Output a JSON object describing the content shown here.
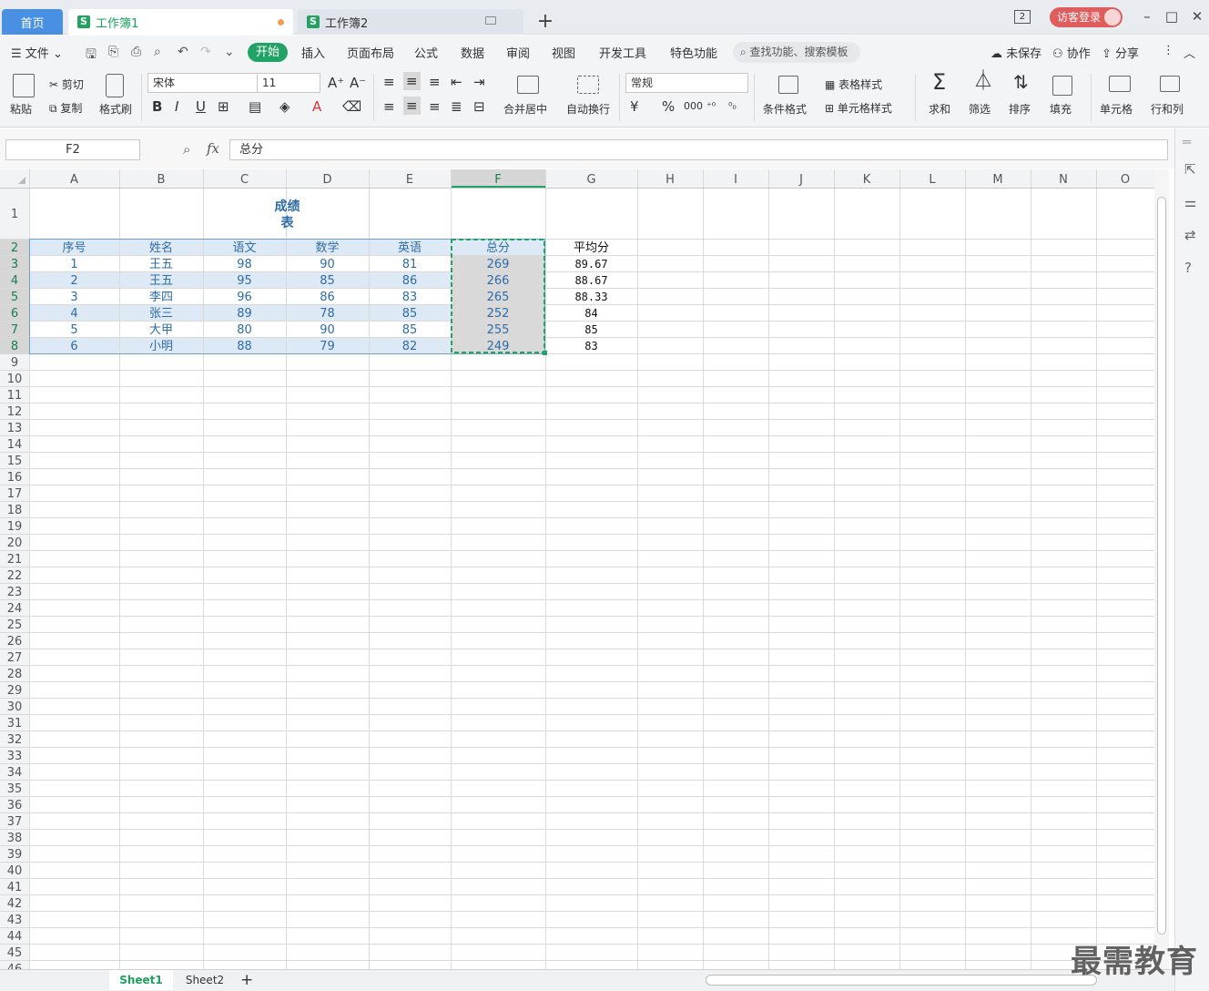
{
  "tabs": {
    "home": "首页",
    "wb1": "工作簿1",
    "wb2": "工作簿2",
    "new": "+"
  },
  "top_right": {
    "window_count": "2",
    "login": "访客登录"
  },
  "menu": {
    "file": "文件",
    "items": [
      "开始",
      "插入",
      "页面布局",
      "公式",
      "数据",
      "审阅",
      "视图",
      "开发工具",
      "特色功能"
    ],
    "search": "查找功能、搜索模板",
    "unsaved": "未保存",
    "collab": "协作",
    "share": "分享"
  },
  "ribbon": {
    "paste": "粘贴",
    "cut": "剪切",
    "copy": "复制",
    "format_painter": "格式刷",
    "font_name": "宋体",
    "font_size": "11",
    "merge": "合并居中",
    "wrap": "自动换行",
    "number_format": "常规",
    "cond_format": "条件格式",
    "table_style": "表格样式",
    "cell_style": "单元格样式",
    "sum": "求和",
    "filter": "筛选",
    "sort": "排序",
    "fill": "填充",
    "cell": "单元格",
    "rowcol": "行和列"
  },
  "formula_bar": {
    "name_box": "F2",
    "fx": "fx",
    "content": "总分"
  },
  "columns": [
    "A",
    "B",
    "C",
    "D",
    "E",
    "F",
    "G",
    "H",
    "I",
    "J",
    "K",
    "L",
    "M",
    "N",
    "O"
  ],
  "row_count": 46,
  "title": [
    "成绩",
    "表"
  ],
  "headers": [
    "序号",
    "姓名",
    "语文",
    "数学",
    "英语",
    "总分",
    "平均分"
  ],
  "rows": [
    [
      "1",
      "王五",
      "98",
      "90",
      "81",
      "269",
      "89.67"
    ],
    [
      "2",
      "王五",
      "95",
      "85",
      "86",
      "266",
      "88.67"
    ],
    [
      "3",
      "李四",
      "96",
      "86",
      "83",
      "265",
      "88.33"
    ],
    [
      "4",
      "张三",
      "89",
      "78",
      "85",
      "252",
      "84"
    ],
    [
      "5",
      "大甲",
      "80",
      "90",
      "85",
      "255",
      "85"
    ],
    [
      "6",
      "小明",
      "88",
      "79",
      "82",
      "249",
      "83"
    ]
  ],
  "sheets": [
    "Sheet1",
    "Sheet2"
  ],
  "watermark": "最需教育",
  "colors": {
    "accent": "#21a366",
    "band": "#dde9f5",
    "text_blue": "#2f6ca8",
    "selected_fill": "#d9d9d9"
  }
}
